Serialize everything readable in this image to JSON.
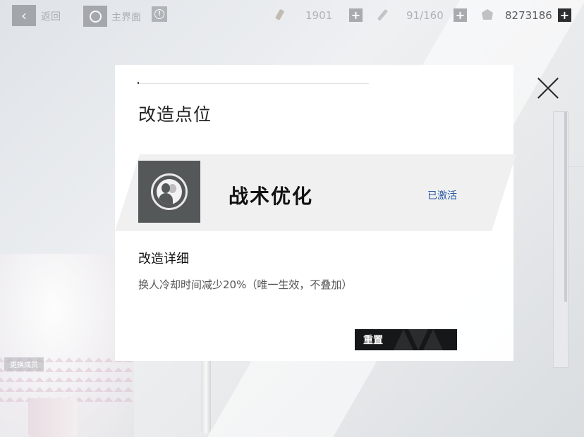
{
  "topbar": {
    "back_label": "返回",
    "home_label": "主界面",
    "resources": [
      {
        "icon": "bullet-icon",
        "value": "1901"
      },
      {
        "icon": "wrench-icon",
        "value": "91/160"
      },
      {
        "icon": "core-icon",
        "value": "8273186"
      }
    ]
  },
  "background": {
    "change_member_label": "更换成员"
  },
  "dialog": {
    "title": "改造点位",
    "module": {
      "icon": "tactical-optimization-icon",
      "name": "战术优化",
      "status": "已激活"
    },
    "detail_title": "改造详细",
    "detail_text": "换人冷却时间减少20%（唯一生效，不叠加）",
    "reset_label": "重置"
  },
  "colors": {
    "status_blue": "#2a5aa6",
    "button_dark": "#161718"
  }
}
